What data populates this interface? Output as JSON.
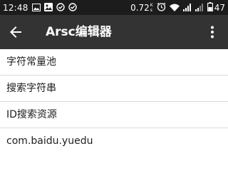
{
  "status_bar": {
    "time": "12:48",
    "network_speed": "0.72",
    "speed_unit_top": "K",
    "speed_unit_bottom": "s",
    "battery_level": "47",
    "left_icons": [
      "image-icon",
      "photo-icon",
      "check-circle-icon",
      "check-circle-icon"
    ],
    "right_icons": [
      "alarm-icon",
      "wifi-icon",
      "signal-icon",
      "signal-icon",
      "battery-icon"
    ]
  },
  "toolbar": {
    "title": "Arsc编辑器",
    "back_icon": "arrow-back-icon",
    "more_icon": "more-vert-icon"
  },
  "menu": {
    "items": [
      {
        "label": "字符常量池"
      },
      {
        "label": "搜索字符串"
      },
      {
        "label": "ID搜索资源"
      },
      {
        "label": "com.baidu.yuedu"
      }
    ]
  },
  "colors": {
    "status_bar_bg": "#1c1c1c",
    "toolbar_bg": "#333333",
    "list_bg": "#ffffff",
    "divider": "#d9d9d9",
    "text": "#1e1e1e"
  }
}
